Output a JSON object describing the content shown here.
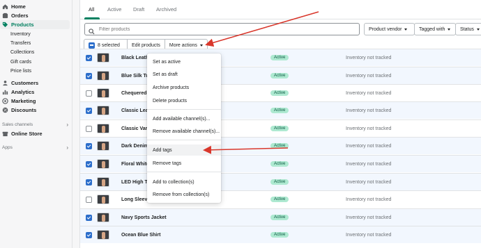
{
  "sidebar": {
    "items": [
      {
        "label": "Home",
        "icon": "home-icon"
      },
      {
        "label": "Orders",
        "icon": "orders-icon"
      },
      {
        "label": "Products",
        "icon": "tag-icon"
      },
      {
        "label": "Inventory"
      },
      {
        "label": "Transfers"
      },
      {
        "label": "Collections"
      },
      {
        "label": "Gift cards"
      },
      {
        "label": "Price lists"
      },
      {
        "label": "Customers",
        "icon": "person-icon"
      },
      {
        "label": "Analytics",
        "icon": "chart-icon"
      },
      {
        "label": "Marketing",
        "icon": "target-icon"
      },
      {
        "label": "Discounts",
        "icon": "discount-icon"
      }
    ],
    "sales_channels_label": "Sales channels",
    "online_store_label": "Online Store",
    "apps_label": "Apps"
  },
  "tabs": [
    "All",
    "Active",
    "Draft",
    "Archived"
  ],
  "search": {
    "placeholder": "Filter products"
  },
  "filters": {
    "vendor": "Product vendor",
    "tagged": "Tagged with",
    "status": "Status"
  },
  "bulk": {
    "selected": "8 selected",
    "edit": "Edit products",
    "more": "More actions"
  },
  "rows": [
    {
      "name": "Black Leathe",
      "checked": true,
      "status": "Active",
      "inventory": "Inventory not tracked"
    },
    {
      "name": "Blue Silk Tux",
      "checked": true,
      "status": "Active",
      "inventory": "Inventory not tracked"
    },
    {
      "name": "Chequered R",
      "checked": false,
      "status": "Active",
      "inventory": "Inventory not tracked"
    },
    {
      "name": "Classic Leat",
      "checked": true,
      "status": "Active",
      "inventory": "Inventory not tracked"
    },
    {
      "name": "Classic Varsi",
      "checked": false,
      "status": "Active",
      "inventory": "Inventory not tracked"
    },
    {
      "name": "Dark Denim T",
      "checked": true,
      "status": "Active",
      "inventory": "Inventory not tracked"
    },
    {
      "name": "Floral White",
      "checked": true,
      "status": "Active",
      "inventory": "Inventory not tracked"
    },
    {
      "name": "LED High Top",
      "checked": true,
      "status": "Active",
      "inventory": "Inventory not tracked"
    },
    {
      "name": "Long Sleeve",
      "checked": false,
      "status": "Active",
      "inventory": "Inventory not tracked"
    },
    {
      "name": "Navy Sports Jacket",
      "checked": true,
      "status": "Active",
      "inventory": "Inventory not tracked"
    },
    {
      "name": "Ocean Blue Shirt",
      "checked": true,
      "status": "Active",
      "inventory": "Inventory not tracked"
    }
  ],
  "menu": {
    "items": [
      "Set as active",
      "Set as draft",
      "Archive products",
      "Delete products",
      "Add available channel(s)...",
      "Remove available channel(s)...",
      "Add tags",
      "Remove tags",
      "Add to collection(s)",
      "Remove from collection(s)"
    ]
  },
  "colors": {
    "accent": "#008060",
    "selected_row": "#f2f7fe",
    "checkbox": "#2c6ecb",
    "badge_bg": "#aee9d1",
    "annotation_arrow": "#d9372b"
  }
}
